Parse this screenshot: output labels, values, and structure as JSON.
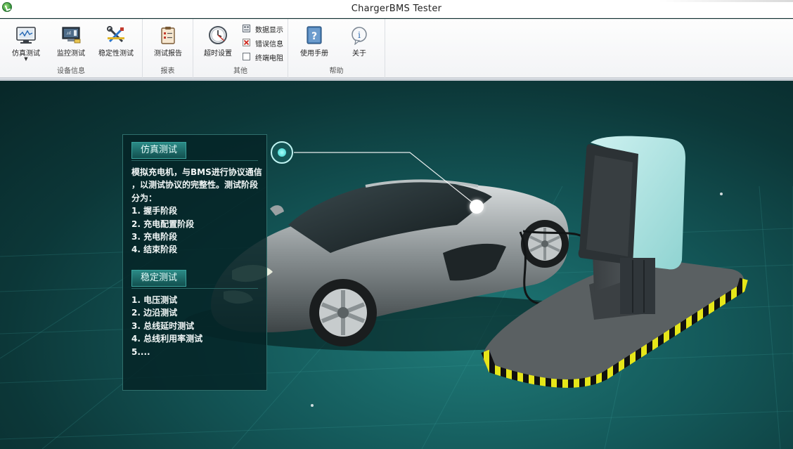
{
  "window": {
    "title": "ChargerBMS Tester"
  },
  "ribbon": {
    "groups": [
      {
        "label": "设备信息",
        "buttons": [
          {
            "label": "仿真测试",
            "icon": "monitor-icon",
            "has_dropdown": true
          },
          {
            "label": "监控测试",
            "icon": "monitor-screen-icon"
          },
          {
            "label": "稳定性测试",
            "icon": "tools-icon"
          }
        ]
      },
      {
        "label": "报表",
        "buttons": [
          {
            "label": "测试报告",
            "icon": "clipboard-icon"
          }
        ]
      },
      {
        "label": "其他",
        "buttons": [
          {
            "label": "超时设置",
            "icon": "clock-icon"
          }
        ],
        "small_buttons": [
          {
            "label": "数据显示",
            "icon": "data-grid-icon"
          },
          {
            "label": "错误信息",
            "icon": "error-icon"
          },
          {
            "label": "终端电阻",
            "icon": "checkbox-icon"
          }
        ]
      },
      {
        "label": "帮助",
        "buttons": [
          {
            "label": "使用手册",
            "icon": "help-book-icon"
          },
          {
            "label": "关于",
            "icon": "info-icon"
          }
        ]
      }
    ]
  },
  "info_panel": {
    "sim_title": "仿真测试",
    "sim_lines": [
      "模拟充电机，与BMS进行协议通信",
      "，以测试协议的完整性。测试阶段",
      "分为：",
      "1. 握手阶段",
      "2. 充电配置阶段",
      "3. 充电阶段",
      "4. 结束阶段"
    ],
    "stab_title": "稳定测试",
    "stab_lines": [
      "1. 电压测试",
      "2. 边沿测试",
      "3. 总线延时测试",
      "4. 总线利用率测试",
      "5...."
    ]
  },
  "colors": {
    "accent": "#2b8a86",
    "stage_dark": "#0b2c2e",
    "charger_screen": "#a9e2e0",
    "hazard_yellow": "#e6e619"
  }
}
